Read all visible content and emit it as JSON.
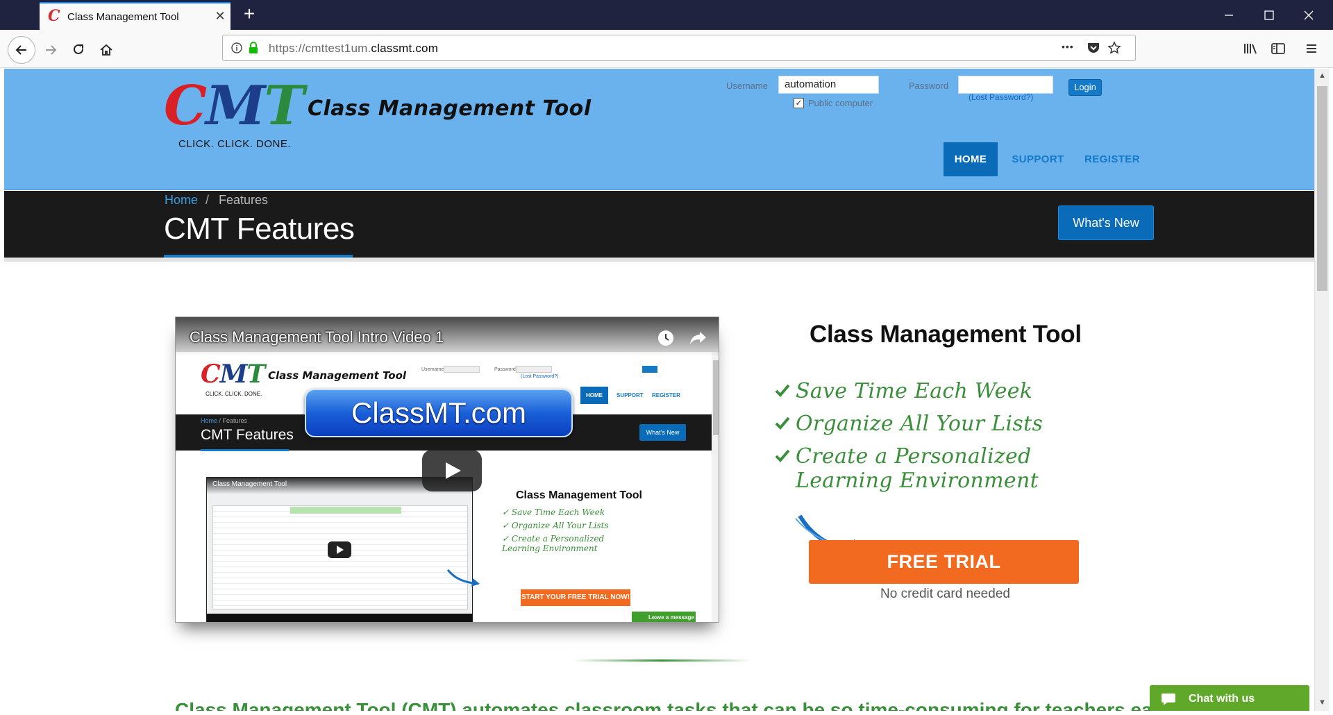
{
  "browser": {
    "tab_title": "Class Management Tool",
    "tab_close": "✕",
    "new_tab": "+",
    "url_host": "https://cmttest1um.",
    "url_domain": "classmt.com",
    "url_dots": "•••"
  },
  "header": {
    "logo": {
      "c": "C",
      "m": "M",
      "t": "T"
    },
    "brand_title": "Class Management Tool",
    "tagline": "CLICK. CLICK. DONE.",
    "login": {
      "username_label": "Username",
      "username_value": "automation",
      "password_label": "Password",
      "login_button": "Login",
      "public_computer_label": "Public computer",
      "public_computer_checked": true,
      "lost_password": "(Lost Password?)"
    },
    "nav": [
      {
        "label": "HOME",
        "active": true
      },
      {
        "label": "SUPPORT",
        "active": false
      },
      {
        "label": "REGISTER",
        "active": false
      }
    ]
  },
  "title_band": {
    "breadcrumb_home": "Home",
    "breadcrumb_separator": "/",
    "breadcrumb_current": "Features",
    "page_title": "CMT Features",
    "whats_new_button": "What's New"
  },
  "video": {
    "title": "Class Management Tool Intro Video 1",
    "watermark": "ClassMT.com",
    "inner": {
      "logo_title": "Class Management Tool",
      "tagline": "CLICK. CLICK. DONE.",
      "username_label": "Username",
      "password_label": "Password",
      "lost_password": "(Lost Password?)",
      "nav_home": "HOME",
      "nav_support": "SUPPORT",
      "nav_register": "REGISTER",
      "breadcrumb": "Home",
      "breadcrumb_current": " / Features",
      "page_title": "CMT Features",
      "whats_new": "What's New",
      "nested_video_title": "Class Management Tool",
      "right_title": "Class Management Tool",
      "features": [
        "Save Time Each Week",
        "Organize All Your Lists",
        "Create a Personalized Learning Environment"
      ],
      "trial_button": "START YOUR FREE TRIAL NOW!",
      "leave_message": "Leave a message"
    }
  },
  "product": {
    "title": "Class Management Tool",
    "features": [
      "Save Time Each Week",
      "Organize All Your Lists",
      "Create a Personalized Learning Environment"
    ],
    "free_trial_button": "FREE TRIAL",
    "no_credit_card": "No credit card needed"
  },
  "intro_text": "Class Management Tool (CMT) automates classroom tasks that can be so time-consuming for teachers each",
  "chat": {
    "label": "Chat with us"
  },
  "colors": {
    "header_bg": "#6ab2ee",
    "accent_blue": "#0a6cb8",
    "band_bg": "#1a1a1a",
    "green": "#3a8f3a",
    "orange": "#f26a1f",
    "chat_green": "#5fa829"
  }
}
